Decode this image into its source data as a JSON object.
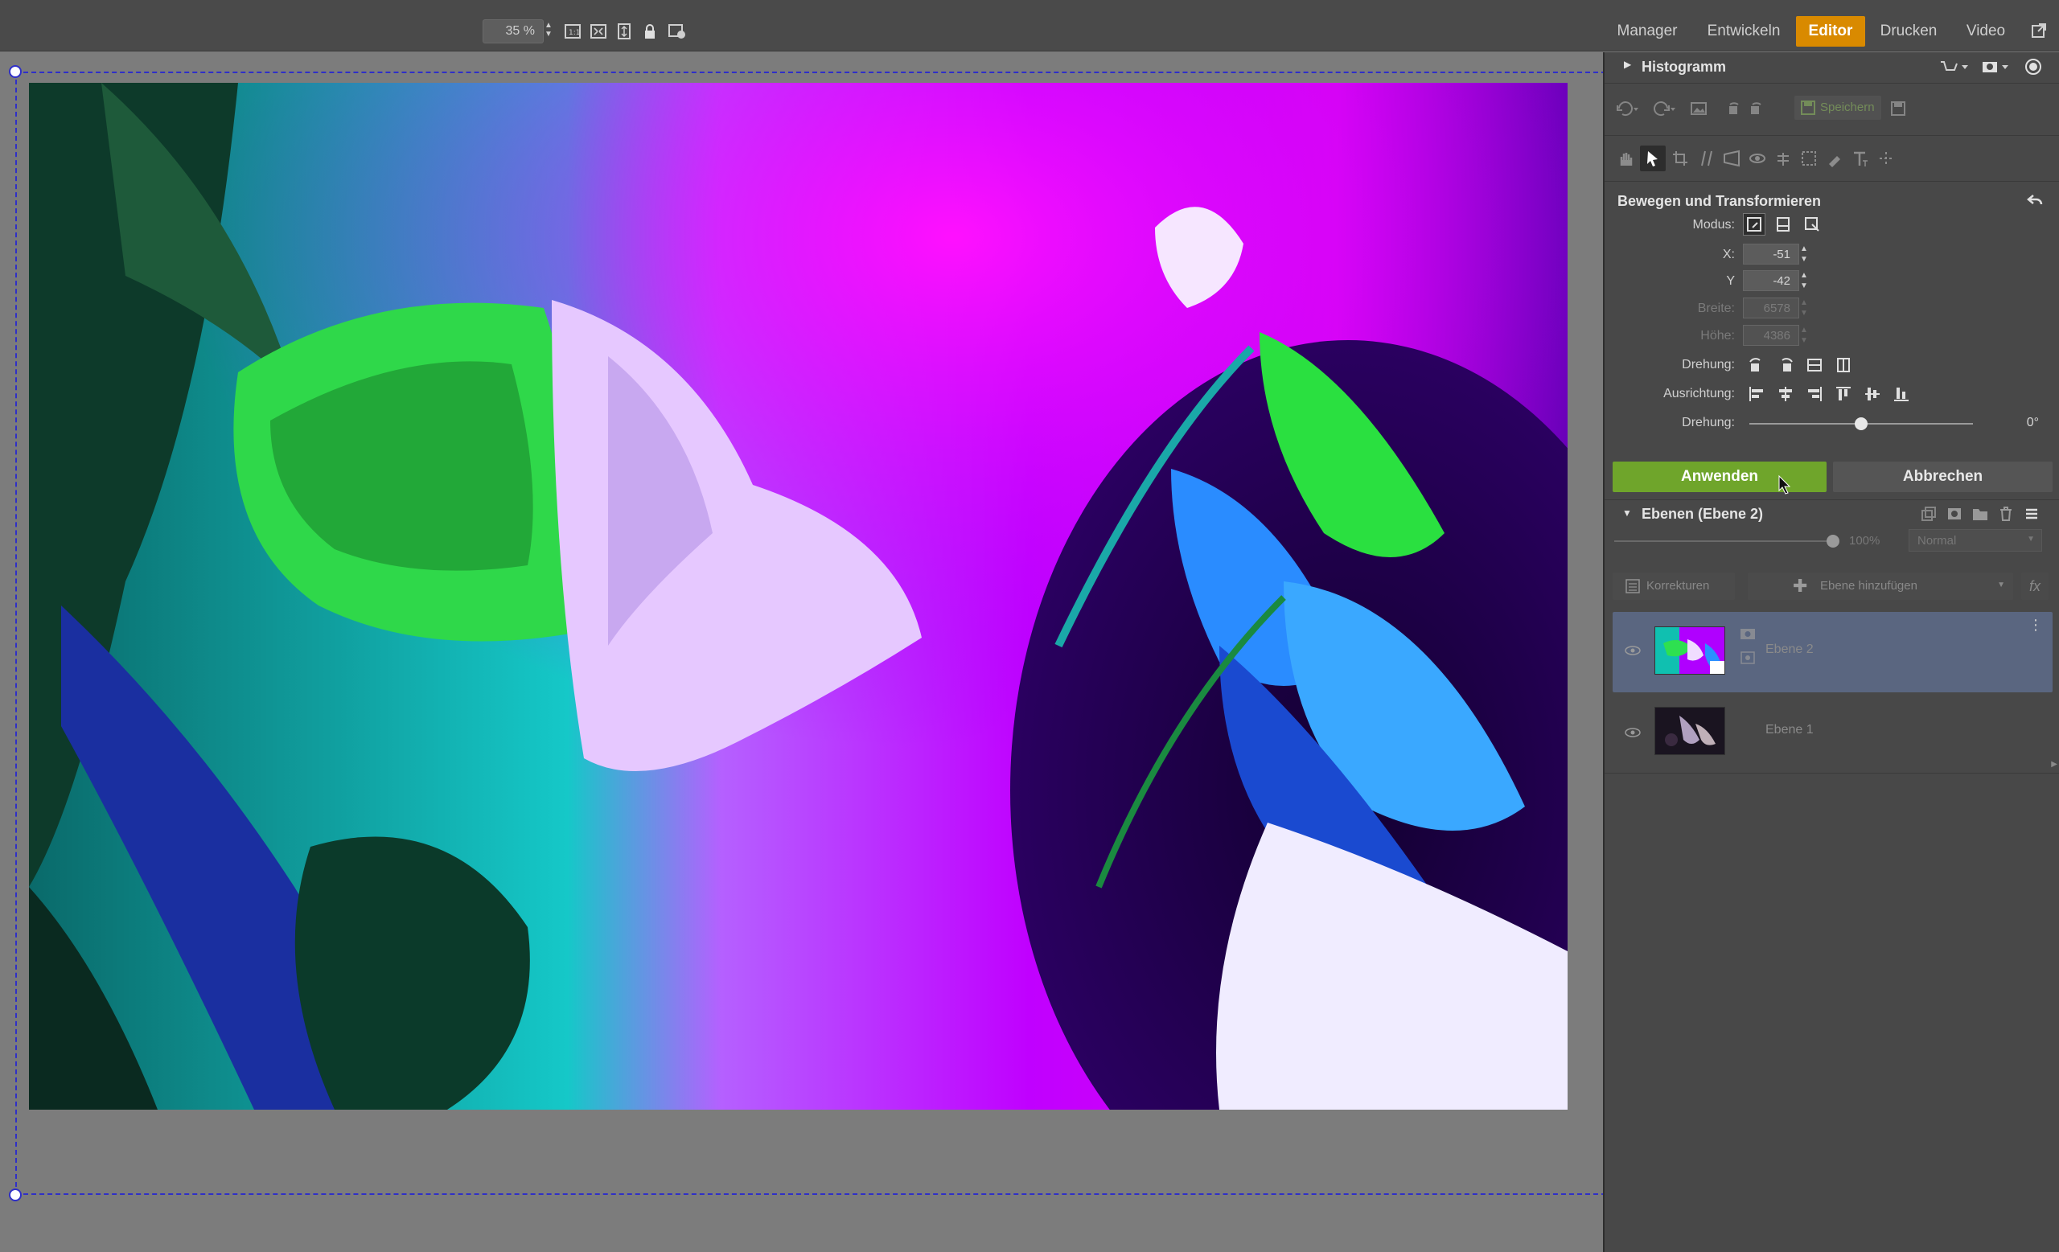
{
  "toolbar": {
    "zoom_value": "35 %",
    "icons": [
      "zoom-1-1-icon",
      "fit-screen-icon",
      "fit-height-icon",
      "lock-icon",
      "guide-settings-icon"
    ]
  },
  "nav": {
    "items": [
      {
        "label": "Manager",
        "active": false
      },
      {
        "label": "Entwickeln",
        "active": false
      },
      {
        "label": "Editor",
        "active": true
      },
      {
        "label": "Drucken",
        "active": false
      },
      {
        "label": "Video",
        "active": false
      }
    ],
    "external_icon": "external-window-icon",
    "accent_color": "#d98a00"
  },
  "panel": {
    "histogram_title": "Histogramm",
    "save_label": "Speichern",
    "tool_title": "Bewegen und Transformieren",
    "modus_label": "Modus:",
    "x_label": "X:",
    "x_value": "-51",
    "y_label": "Y",
    "y_value": "-42",
    "width_label": "Breite:",
    "width_value": "6578",
    "height_label": "Höhe:",
    "height_value": "4386",
    "rotation_label": "Drehung:",
    "align_label": "Ausrichtung:",
    "rotation2_label": "Drehung:",
    "rotation_value": "0°",
    "rotation_level": 0.5,
    "apply_label": "Anwenden",
    "cancel_label": "Abbrechen",
    "apply_color": "#6fa52b"
  },
  "layers": {
    "title": "Ebenen (Ebene 2)",
    "opacity": "100%",
    "blend_mode": "Normal",
    "corrections_label": "Korrekturen",
    "add_layer_label": "Ebene hinzufügen",
    "fx_label": "fx",
    "items": [
      {
        "name": "Ebene 2",
        "selected": true
      },
      {
        "name": "Ebene 1",
        "selected": false
      }
    ],
    "selected_color": "#5a6680"
  }
}
